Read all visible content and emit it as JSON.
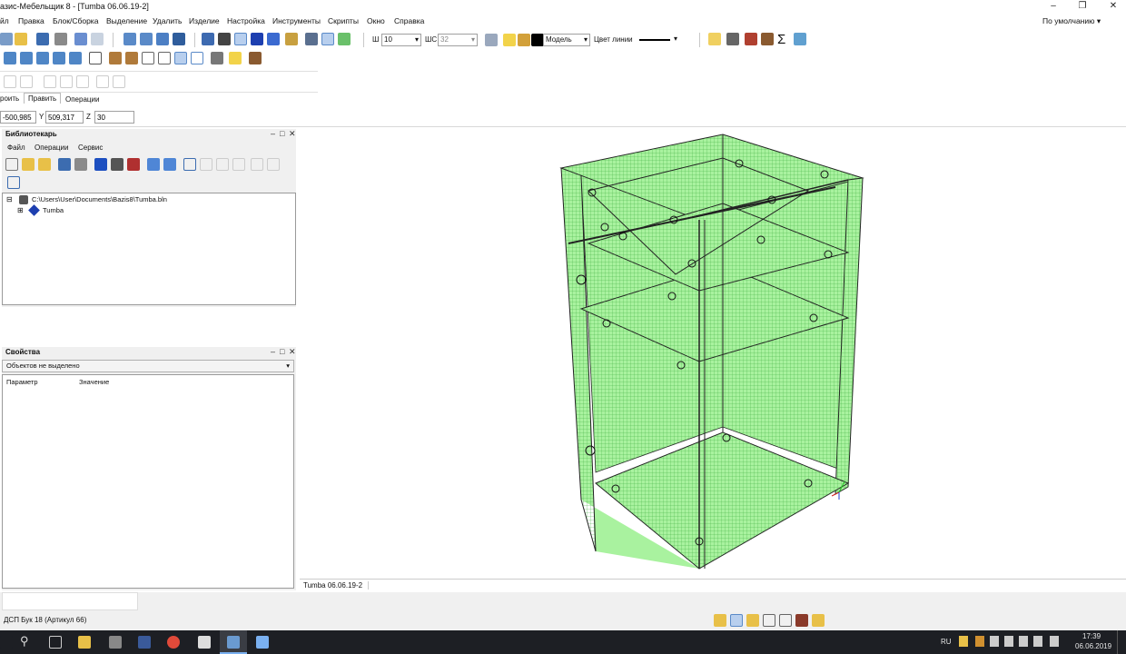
{
  "window": {
    "title": "азис-Мебельщик 8 - [Tumba 06.06.19-2]",
    "preset": "По умолчанию"
  },
  "menu": [
    "йл",
    "Правка",
    "Блок/Сборка",
    "Выделение",
    "Удалить",
    "Изделие",
    "Настройка",
    "Инструменты",
    "Скрипты",
    "Окно",
    "Справка"
  ],
  "toolbar": {
    "w_label": "Ш",
    "w_value": "10",
    "ws_label": "ШС",
    "ws_value": "32",
    "layer_value": "Модель",
    "line_color_label": "Цвет линии"
  },
  "tabs": [
    "роить",
    "Править",
    "Операции"
  ],
  "coords": {
    "x_value": "-500,985",
    "y_label": "Y",
    "y_value": "509,317",
    "z_label": "Z",
    "z_value": "30"
  },
  "librarian": {
    "title": "Библиотекарь",
    "menu": [
      "Файл",
      "Операции",
      "Сервис"
    ],
    "tree_path": "C:\\Users\\User\\Documents\\Bazis8\\Tumba.bln",
    "tree_child": "Tumba"
  },
  "properties": {
    "title": "Свойства",
    "selection": "Объектов не выделено",
    "col_param": "Параметр",
    "col_value": "Значение"
  },
  "viewport": {
    "tab": "Tumba 06.06.19-2"
  },
  "status": {
    "material": "ДСП Бук 18 (Артикул 66)"
  },
  "taskbar": {
    "lang": "RU",
    "time": "17:39",
    "date": "06.06.2019"
  },
  "colors": {
    "model_fill": "#a9f29f",
    "model_grid": "#3fae3f",
    "panel_bg": "#f0f0f0",
    "taskbar": "#1d1f24"
  }
}
